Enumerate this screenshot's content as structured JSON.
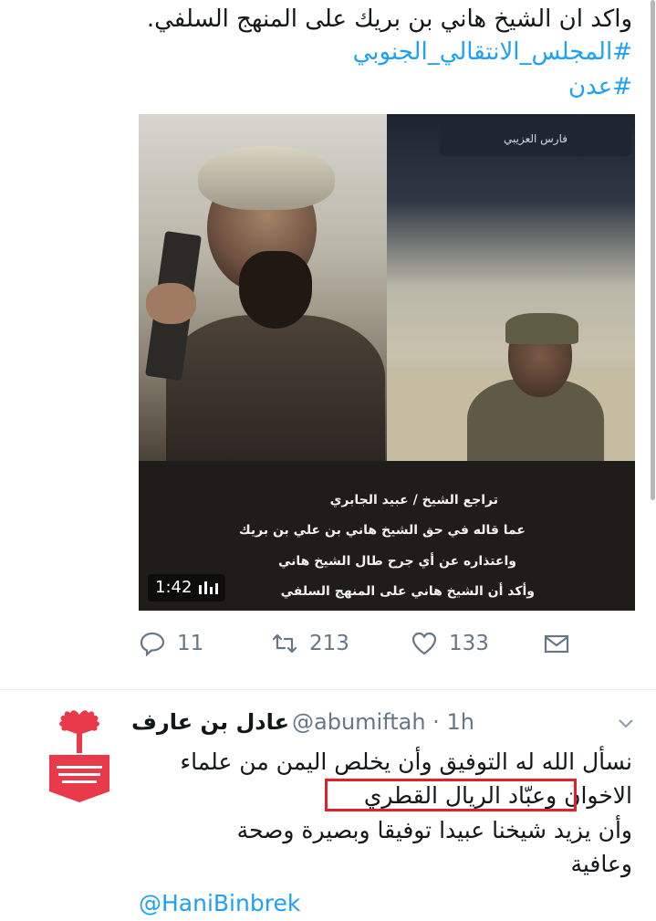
{
  "tweet": {
    "text_line": "واكد ان الشيخ هاني بن بريك على المنهج السلفي.",
    "hashtags": [
      "#المجلس_الانتقالي_الجنوبي",
      "#عدن"
    ]
  },
  "media": {
    "name_tag": "فارس العزيبي",
    "caption_lines": [
      "تراجع الشيخ / عبيد الجابري",
      "عما قاله في حق الشيخ هاني بن علي بن بريك",
      "واعتذاره عن أي جرح طال الشيخ هاني",
      "وأكد أن الشيخ هاني على المنهج السلفي"
    ],
    "duration": "1:42"
  },
  "actions": {
    "replies": "11",
    "retweets": "213",
    "likes": "133"
  },
  "reply": {
    "name": "عادل بن عارف",
    "handle": "@abumiftah · 1h",
    "lines": [
      "نسأل الله له التوفيق وأن يخلص اليمن من علماء",
      "الاخوان وعبّاد الريال القطري",
      "وأن يزيد شيخنا عبيدا توفيقا وبصيرة وصحة",
      "وعافية"
    ],
    "mention": "@HaniBinbrek"
  },
  "colors": {
    "link": "#1da1f2",
    "muted": "#657786",
    "highlight": "#e0202a"
  }
}
